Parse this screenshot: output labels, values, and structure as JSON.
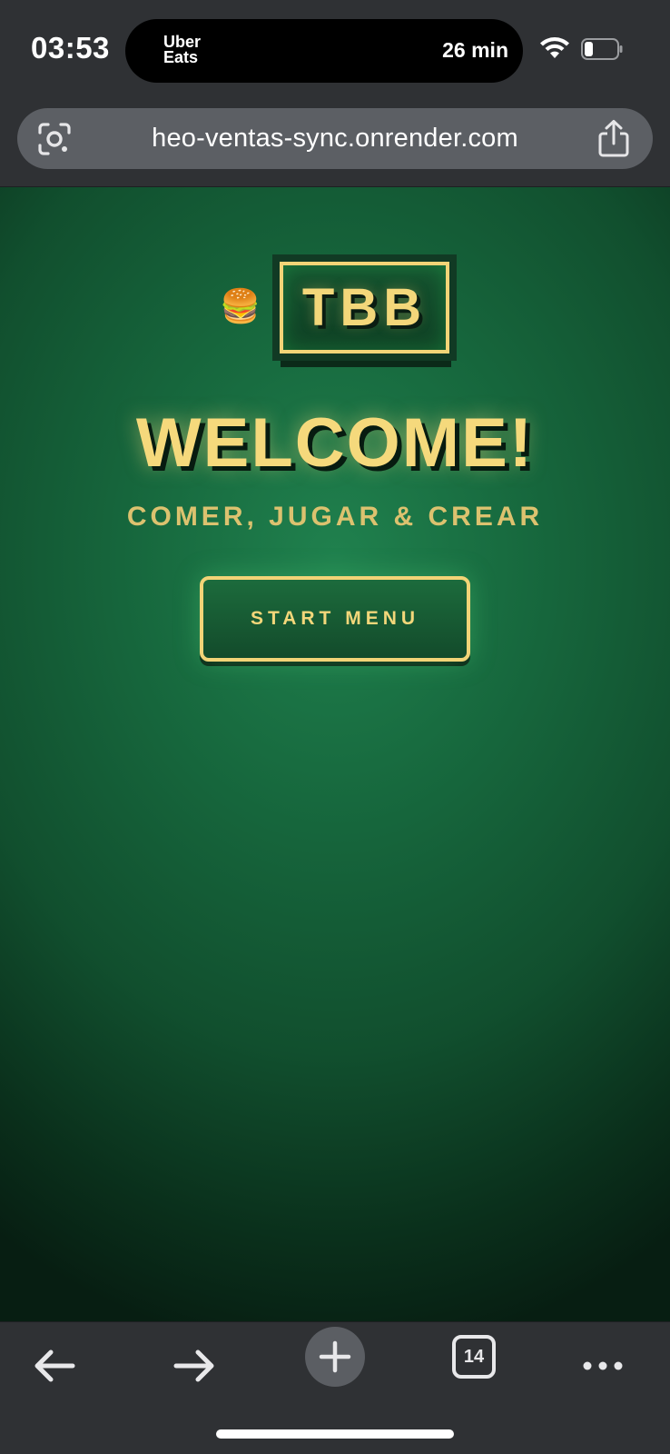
{
  "status_bar": {
    "time": "03:53",
    "live_activity": {
      "brand_line1": "Uber",
      "brand_line2": "Eats",
      "eta": "26 min"
    },
    "icons": [
      "wifi-icon",
      "battery-icon"
    ]
  },
  "browser": {
    "url": "heo-ventas-sync.onrender.com",
    "icons": [
      "lens-icon",
      "share-icon"
    ],
    "toolbar": {
      "tab_count": "14",
      "icons": [
        "back-arrow-icon",
        "forward-arrow-icon",
        "plus-icon",
        "tabs-icon",
        "more-icon"
      ]
    }
  },
  "page": {
    "logo_emoji": "🍔",
    "logo_text": "TBB",
    "headline": "WELCOME!",
    "tagline": "COMER, JUGAR & CREAR",
    "start_button": "START MENU",
    "colors": {
      "accent": "#f2d477",
      "background": "#17693e",
      "background_dark": "#071e12"
    }
  }
}
